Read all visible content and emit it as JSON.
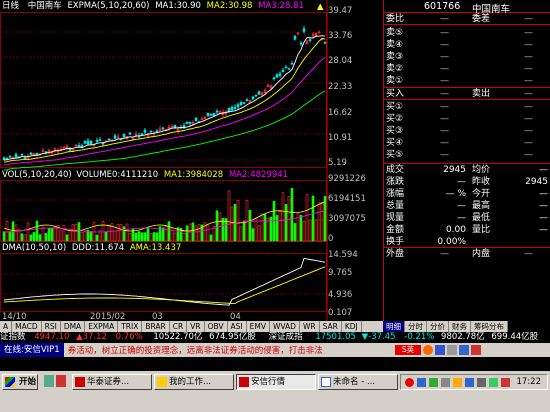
{
  "chart_header": {
    "period": "日线",
    "stock_name": "中国南车",
    "expma_label": "EXPMA(5,10,20,60)",
    "ma1": "MA1:30.90",
    "ma2": "MA2:30.98",
    "ma3": "MA3:28.81"
  },
  "price_axis": [
    "39.47",
    "33.76",
    "28.04",
    "22.33",
    "16.62",
    "10.91",
    "5.19"
  ],
  "vol_header": {
    "label": "VOL(5,10,20,40)",
    "volume": "VOLUME0:4111210",
    "ma1": "MA1:3984028",
    "ma2": "MA2:4829941"
  },
  "vol_axis": [
    "9291226",
    "6194151",
    "3097075",
    "0"
  ],
  "dma_header": {
    "label": "DMA(10,50,10)",
    "ddd": "DDD:11.674",
    "ama": "AMA:13.437"
  },
  "dma_axis": [
    "14.594",
    "9.765",
    "4.936",
    "0.107"
  ],
  "date_axis": [
    "14/10",
    "2015/02",
    "03",
    "04"
  ],
  "indicator_tabs": [
    "A",
    "MACD",
    "RSI",
    "DMA",
    "EXPMA",
    "TRIX",
    "BRAR",
    "CR",
    "VR",
    "OBV",
    "ASI",
    "EMV",
    "WVAD",
    "WR",
    "SAR",
    "KDJ"
  ],
  "side_tabs": [
    "明细",
    "分时",
    "分价",
    "财务",
    "筹码分布"
  ],
  "quote": {
    "code": "601766",
    "name": "中国南车",
    "committee_ratio_label": "委比",
    "committee_diff_label": "委差",
    "committee_ratio": "—",
    "committee_diff": "—",
    "sell_levels": [
      "卖⑤",
      "卖④",
      "卖③",
      "卖②",
      "卖①"
    ],
    "buy_levels": [
      "买①",
      "买②",
      "买③",
      "买④",
      "买⑤"
    ],
    "buy_in_label": "买入",
    "sell_out_label": "卖出",
    "dash": "—",
    "fields": [
      {
        "l": "成交",
        "v": "2945",
        "r": "均价",
        "rv": "—"
      },
      {
        "l": "涨跌",
        "v": "—",
        "r": "昨收",
        "rv": "2945"
      },
      {
        "l": "涨幅",
        "v": "— %",
        "r": "今开",
        "rv": "—"
      },
      {
        "l": "总量",
        "v": "—",
        "r": "最高",
        "rv": "—"
      },
      {
        "l": "现量",
        "v": "—",
        "r": "最低",
        "rv": "—"
      },
      {
        "l": "金额",
        "v": "0.00",
        "r": "量比",
        "rv": "—"
      },
      {
        "l": "换手",
        "v": "0.00%",
        "r": "",
        "rv": ""
      }
    ],
    "outer_label": "外盘",
    "inner_label": "内盘",
    "outer": "—",
    "inner": "—"
  },
  "ticker": {
    "index_name": "证指数",
    "price": "4947.10",
    "change": "37.12",
    "pct": "0.76%",
    "amount": "10522.70亿",
    "vol": "674.95亿股",
    "shenzhen_name": "深证成指",
    "sz_price": "17501.05",
    "sz_change": "-37.45",
    "sz_pct": "-0.21%",
    "sz_amount": "9802.78亿",
    "sz_vol": "699.44亿股"
  },
  "status": {
    "online": "在线:安信VIP1",
    "message": "券活动，树立正确的投资理念，远离非法证券活动的侵害，打击非法"
  },
  "taskbar": {
    "start": "开始",
    "tasks": [
      "华泰证券...",
      "我的工作...",
      "安信行情",
      "未命名 - ..."
    ],
    "time": "17:22"
  },
  "colors": {
    "price_up": "#ff3232",
    "price_down": "#00e6e6",
    "ma1": "#ffffff",
    "ma2": "#ffff00",
    "ma3": "#ff00ff",
    "ma4": "#00ff00",
    "grid": "#8b0000"
  }
}
